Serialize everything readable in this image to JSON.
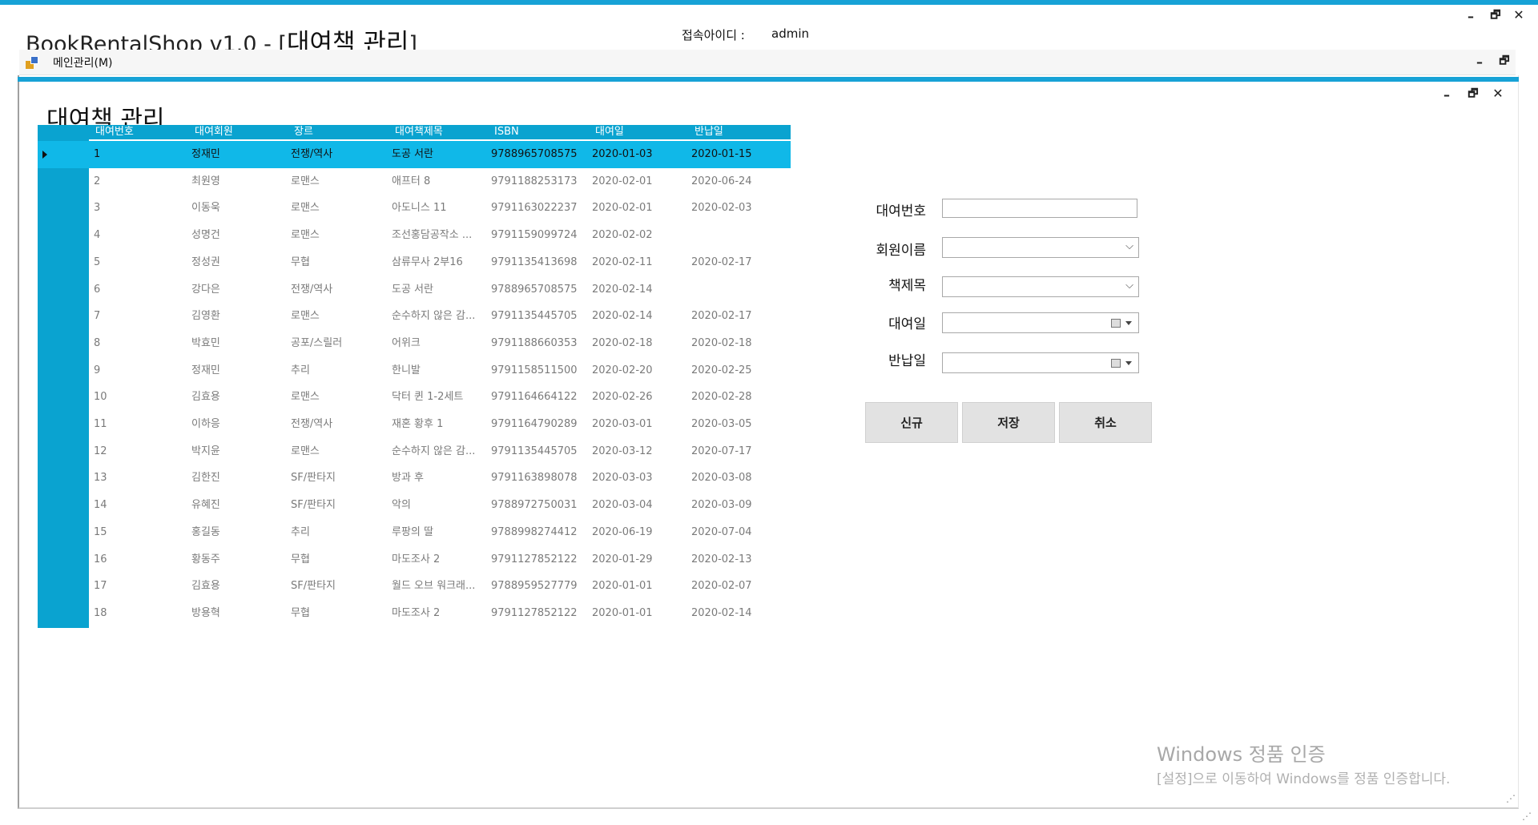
{
  "window": {
    "app_title": "BookRentalShop v1.0 - [",
    "child_title_inline": "대여책 관리",
    "title_close": "]",
    "login_label": "접속아이디 :",
    "login_user": "admin",
    "min_glyph": "–",
    "restore_glyph": "🗗",
    "close_glyph": "✕"
  },
  "menu": {
    "main_label": "메인관리(M)"
  },
  "child": {
    "title": "대여책 관리"
  },
  "grid": {
    "columns": [
      "대여번호",
      "대여회원",
      "장르",
      "대여책제목",
      "ISBN",
      "대여일",
      "반납일"
    ],
    "rows": [
      [
        "1",
        "정재민",
        "전쟁/역사",
        "도공 서란",
        "9788965708575",
        "2020-01-03",
        "2020-01-15"
      ],
      [
        "2",
        "최원영",
        "로맨스",
        "애프터 8",
        "9791188253173",
        "2020-02-01",
        "2020-06-24"
      ],
      [
        "3",
        "이동욱",
        "로맨스",
        "아도니스 11",
        "9791163022237",
        "2020-02-01",
        "2020-02-03"
      ],
      [
        "4",
        "성명건",
        "로맨스",
        "조선홍담공작소 ...",
        "9791159099724",
        "2020-02-02",
        ""
      ],
      [
        "5",
        "정성권",
        "무협",
        "삼류무사 2부16",
        "9791135413698",
        "2020-02-11",
        "2020-02-17"
      ],
      [
        "6",
        "강다은",
        "전쟁/역사",
        "도공 서란",
        "9788965708575",
        "2020-02-14",
        ""
      ],
      [
        "7",
        "김영환",
        "로맨스",
        "순수하지 않은 감...",
        "9791135445705",
        "2020-02-14",
        "2020-02-17"
      ],
      [
        "8",
        "박효민",
        "공포/스릴러",
        "어위크",
        "9791188660353",
        "2020-02-18",
        "2020-02-18"
      ],
      [
        "9",
        "정재민",
        "추리",
        "한니발",
        "9791158511500",
        "2020-02-20",
        "2020-02-25"
      ],
      [
        "10",
        "김효용",
        "로맨스",
        "닥터 퀸 1-2세트",
        "9791164664122",
        "2020-02-26",
        "2020-02-28"
      ],
      [
        "11",
        "이하응",
        "전쟁/역사",
        "재혼 황후 1",
        "9791164790289",
        "2020-03-01",
        "2020-03-05"
      ],
      [
        "12",
        "박지윤",
        "로맨스",
        "순수하지 않은 감...",
        "9791135445705",
        "2020-03-12",
        "2020-07-17"
      ],
      [
        "13",
        "김한진",
        "SF/판타지",
        "방과 후",
        "9791163898078",
        "2020-03-03",
        "2020-03-08"
      ],
      [
        "14",
        "유혜진",
        "SF/판타지",
        "악의",
        "9788972750031",
        "2020-03-04",
        "2020-03-09"
      ],
      [
        "15",
        "홍길동",
        "추리",
        "루팡의 딸",
        "9788998274412",
        "2020-06-19",
        "2020-07-04"
      ],
      [
        "16",
        "황동주",
        "무협",
        "마도조사 2",
        "9791127852122",
        "2020-01-29",
        "2020-02-13"
      ],
      [
        "17",
        "김효용",
        "SF/판타지",
        "월드 오브 워크래...",
        "9788959527779",
        "2020-01-01",
        "2020-02-07"
      ],
      [
        "18",
        "방용혁",
        "무협",
        "마도조사 2",
        "9791127852122",
        "2020-01-01",
        "2020-02-14"
      ]
    ]
  },
  "form": {
    "rental_no_label": "대여번호",
    "member_label": "회원이름",
    "book_label": "책제목",
    "rent_date_label": "대여일",
    "return_date_label": "반납일",
    "rental_no_value": "",
    "member_value": "",
    "book_value": "",
    "rent_date_value": "",
    "return_date_value": ""
  },
  "buttons": {
    "new": "신규",
    "save": "저장",
    "cancel": "취소"
  },
  "watermark": {
    "line1": "Windows 정품 인증",
    "line2": "[설정]으로 이동하여 Windows를 정품 인증합니다."
  },
  "colors": {
    "accent": "#17a2d6",
    "grid_header": "#0aa3d0",
    "selected_row": "#10b8e8"
  }
}
